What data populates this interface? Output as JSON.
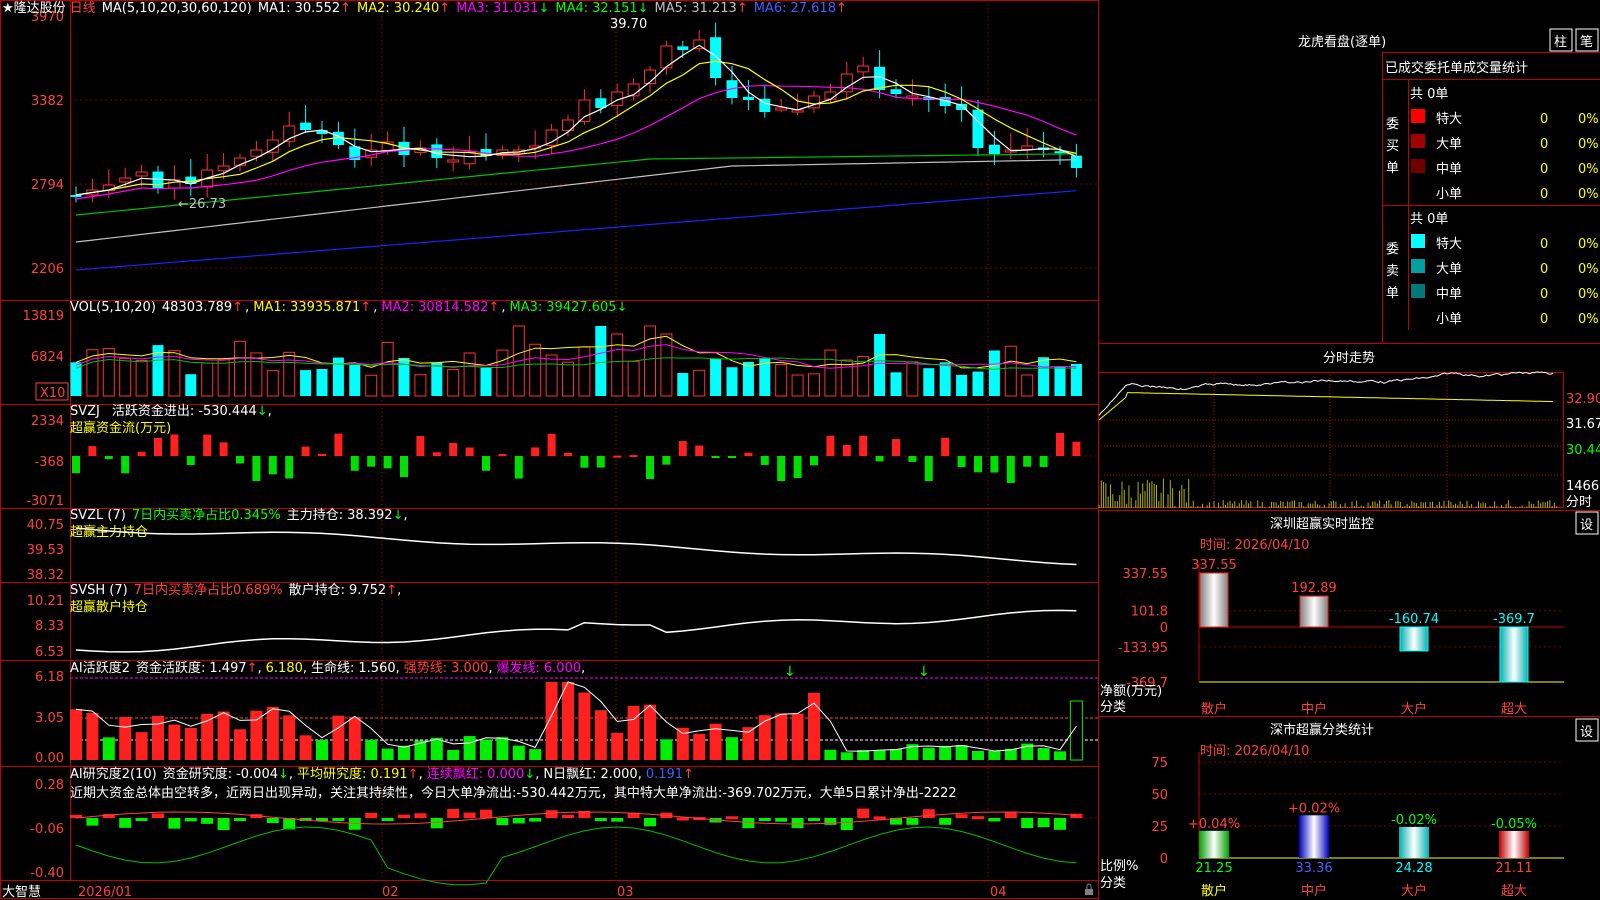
{
  "stock": {
    "star": "★",
    "name": "隆达股份",
    "period": "日线",
    "ma_label": "MA(5,10,20,30,60,120)",
    "ma": [
      {
        "label": "MA1:",
        "value": "30.552",
        "arrow": "↑",
        "color": "#ffffff"
      },
      {
        "label": "MA2:",
        "value": "30.240",
        "arrow": "↑",
        "color": "#ffff00"
      },
      {
        "label": "MA3:",
        "value": "31.031",
        "arrow": "↓",
        "color": "#ff00ff"
      },
      {
        "label": "MA4:",
        "value": "32.151",
        "arrow": "↓",
        "color": "#00ff00"
      },
      {
        "label": "MA5:",
        "value": "31.213",
        "arrow": "↑",
        "color": "#c0c0c0"
      },
      {
        "label": "MA6:",
        "value": "27.618",
        "arrow": "↑",
        "color": "#0000ff"
      }
    ],
    "high_label": "39.70",
    "low_label": "←26.73",
    "y_ticks": [
      "3970",
      "3382",
      "2794",
      "2206"
    ]
  },
  "vol": {
    "title": "VOL(5,10,20)",
    "value": "48303.789",
    "arrow": "↑",
    "ma": [
      {
        "label": "MA1:",
        "value": "33935.871",
        "arrow": "↑",
        "color": "#ffff00"
      },
      {
        "label": "MA2:",
        "value": "30814.582",
        "arrow": "↑",
        "color": "#ff00ff"
      },
      {
        "label": "MA3:",
        "value": "39427.605",
        "arrow": "↓",
        "color": "#00ff00"
      }
    ],
    "y_ticks": [
      "13819",
      "6824"
    ],
    "unit": "X10"
  },
  "svzj": {
    "title": "SVZJ",
    "label": "活跃资金进出:",
    "value": "-530.444",
    "arrow": "↓",
    "sub": "超赢资金流(万元)",
    "y_ticks": [
      "2334",
      "-368",
      "-3071"
    ]
  },
  "svzl": {
    "title": "SVZL (7)",
    "label": "7日内买卖净占比",
    "pct": "0.345%",
    "hold_label": "主力持仓:",
    "hold": "38.392",
    "arrow": "↓",
    "sub": "超赢主力持仓",
    "y_ticks": [
      "40.75",
      "39.53",
      "38.32"
    ]
  },
  "svsh": {
    "title": "SVSH (7)",
    "label": "7日内买卖净占比",
    "pct": "0.689%",
    "hold_label": "散户持仓:",
    "hold": "9.752",
    "arrow": "↑",
    "sub": "超赢散户持仓",
    "y_ticks": [
      "10.21",
      "8.33",
      "6.53"
    ]
  },
  "ai1": {
    "title": "AI活跃度2",
    "label1": "资金活跃度:",
    "v1": "1.497",
    "arrow1": "↑",
    "v2": "6.180",
    "label3": "生命线:",
    "v3": "1.560",
    "label4": "强势线:",
    "v4": "3.000",
    "label5": "爆发线:",
    "v5": "6.000",
    "y_ticks": [
      "6.18",
      "3.05",
      "0.00"
    ]
  },
  "ai2": {
    "title": "AI研究度2(10)",
    "label1": "资金研究度:",
    "v1": "-0.004",
    "arrow1": "↓",
    "label2": "平均研究度:",
    "v2": "0.191",
    "arrow2": "↑",
    "label3": "连续飘红:",
    "v3": "0.000",
    "arrow3": "↓",
    "label4": "N日飘红:",
    "v4": "2.000",
    "v5": "0.191",
    "arrow5": "↑",
    "comment": "近期大资金总体由空转多，近两日出现异动，关注其持续性，今日大单净流出:-530.442万元，其中特大单净流出:-369.702万元，大单5日累计净出-2222",
    "y_ticks": [
      "0.28",
      "-0.06",
      "-0.40"
    ]
  },
  "xaxis": {
    "brand": "大智慧",
    "labels": [
      "2026/01",
      "02",
      "03",
      "04"
    ]
  },
  "lhb": {
    "title": "龙虎看盘(逐单)",
    "btn1": "柱",
    "btn2": "笔",
    "tabs": "已成交委托单成交量统计",
    "buy_side": "委买单",
    "sell_side": "委卖单",
    "buy_total": "共 0单",
    "sell_total": "共 0单",
    "buy_rows": [
      {
        "label": "特大",
        "count": "0",
        "pct": "0%",
        "color": "#ff0000"
      },
      {
        "label": "大单",
        "count": "0",
        "pct": "0%",
        "color": "#a00000"
      },
      {
        "label": "中单",
        "count": "0",
        "pct": "0%",
        "color": "#700000"
      },
      {
        "label": "小单",
        "count": "0",
        "pct": "0%",
        "color": ""
      }
    ],
    "sell_rows": [
      {
        "label": "特大",
        "count": "0",
        "pct": "0%",
        "color": "#00ffff"
      },
      {
        "label": "大单",
        "count": "0",
        "pct": "0%",
        "color": "#00a0a0"
      },
      {
        "label": "中单",
        "count": "0",
        "pct": "0%",
        "color": "#007878"
      },
      {
        "label": "小单",
        "count": "0",
        "pct": "0%",
        "color": ""
      }
    ]
  },
  "fenshi": {
    "title": "分时走势",
    "right_labels": [
      "32.90",
      "31.67",
      "30.44",
      "1466"
    ],
    "bottom_label": "分时"
  },
  "sz_monitor": {
    "title": "深圳超赢实时监控",
    "btn": "设",
    "time": "时间: 2026/04/10",
    "y_ticks": [
      "337.55",
      "101.8",
      "0",
      "-133.95",
      "-369.7"
    ],
    "ylabel1": "净额(万元)",
    "ylabel2": "分类",
    "categories": [
      "散户",
      "中户",
      "大户",
      "超大"
    ],
    "values": [
      337.55,
      192.89,
      -160.74,
      -369.7
    ],
    "value_labels": [
      "337.55",
      "192.89",
      "-160.74",
      "-369.7"
    ]
  },
  "sz_class": {
    "title": "深市超赢分类统计",
    "btn": "设",
    "time": "时间: 2026/04/10",
    "y_ticks": [
      "75",
      "50",
      "25",
      "0"
    ],
    "ylabel1": "比例%",
    "ylabel2": "分类",
    "categories": [
      "散户",
      "中户",
      "大户",
      "超大"
    ],
    "values": [
      21.25,
      33.36,
      24.28,
      21.11
    ],
    "value_labels": [
      "21.25",
      "33.36",
      "24.28",
      "21.11"
    ],
    "change_labels": [
      "+0.04%",
      "+0.02%",
      "-0.02%",
      "-0.05%"
    ]
  },
  "chart_data": {
    "type": "bar",
    "title": "深圳超赢实时监控",
    "categories": [
      "散户",
      "中户",
      "大户",
      "超大"
    ],
    "values": [
      337.55,
      192.89,
      -160.74,
      -369.7
    ],
    "ylabel": "净额(万元)",
    "xlabel": "分类",
    "ylim": [
      -369.7,
      337.55
    ]
  }
}
